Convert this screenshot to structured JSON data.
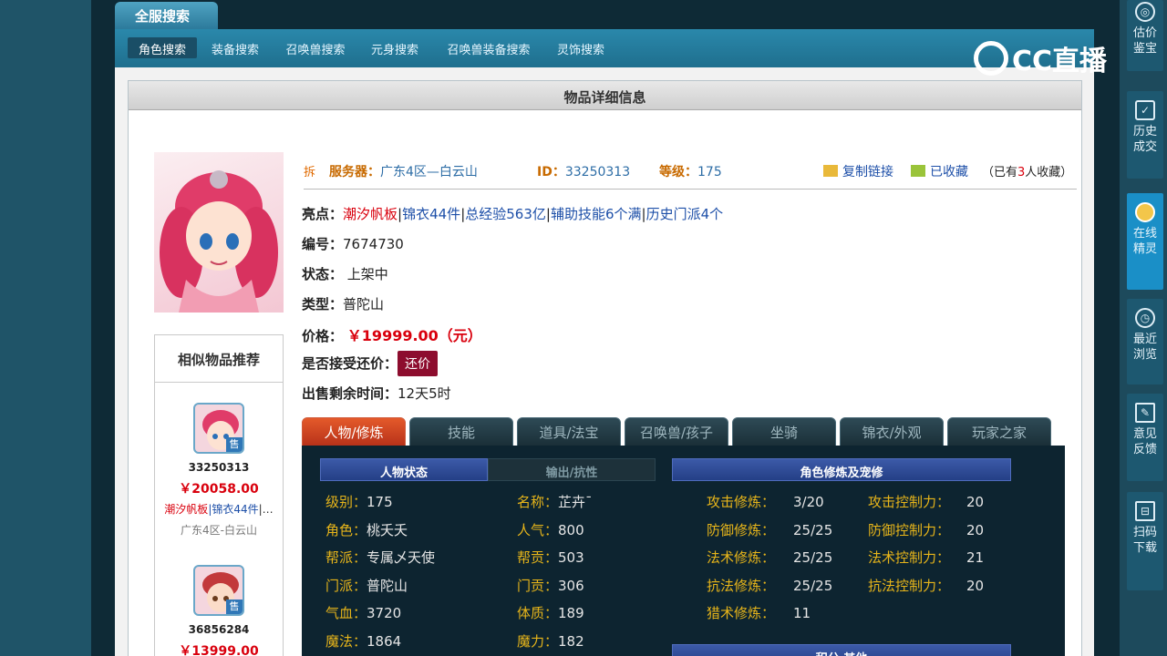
{
  "header": {
    "search_title": "全服搜索"
  },
  "tabs": [
    {
      "label": "角色搜索"
    },
    {
      "label": "装备搜索"
    },
    {
      "label": "召唤兽搜索"
    },
    {
      "label": "元身搜索"
    },
    {
      "label": "召唤兽装备搜索"
    },
    {
      "label": "灵饰搜索"
    }
  ],
  "panel": {
    "title": "物品详细信息"
  },
  "info": {
    "mark": "拆",
    "server_label": "服务器：",
    "server_value": "广东4区—白云山",
    "id_label": "ID：",
    "id_value": "33250313",
    "level_label": "等级：",
    "level_value": "175",
    "copy_link": "复制链接",
    "favorited": "已收藏",
    "fav_count_pre": "（已有",
    "fav_count": "3",
    "fav_count_post": "人收藏）"
  },
  "highlights": {
    "label": "亮点：",
    "items": [
      "潮汐帆板",
      "锦衣44件",
      "总经验563亿",
      "辅助技能6个满",
      "历史门派4个"
    ]
  },
  "details": {
    "serial_label": "编号：",
    "serial_value": "7674730",
    "status_label": "状态：",
    "status_value": "上架中",
    "type_label": "类型：",
    "type_value": "普陀山",
    "price_label": "价格：",
    "price_value": "￥19999.00（元）",
    "haggle_label": "是否接受还价：",
    "haggle_button": "还价",
    "remaining_label": "出售剩余时间：",
    "remaining_value": "12天5时"
  },
  "recommend": {
    "title": "相似物品推荐",
    "items": [
      {
        "id": "33250313",
        "price": "￥20058.00",
        "tag1": "潮汐帆板",
        "tag2": "锦衣44件",
        "more": "|…",
        "server": "广东4区-白云山",
        "sale": "售"
      },
      {
        "id": "36856284",
        "price": "￥13999.00",
        "sale": "售"
      }
    ]
  },
  "content_tabs": [
    "人物/修炼",
    "技能",
    "道具/法宝",
    "召唤兽/孩子",
    "坐骑",
    "锦衣/外观",
    "玩家之家"
  ],
  "char_status": {
    "head_active": "人物状态",
    "head_inactive": "输出/抗性",
    "rows_left": [
      {
        "k": "级别：",
        "v": "175"
      },
      {
        "k": "角色：",
        "v": "桃夭夭"
      },
      {
        "k": "帮派：",
        "v": "专属乄天使"
      },
      {
        "k": "门派：",
        "v": "普陀山"
      },
      {
        "k": "气血：",
        "v": "3720"
      },
      {
        "k": "魔法：",
        "v": "1864"
      }
    ],
    "rows_right": [
      {
        "k": "名称：",
        "v": "芷卉ˉ"
      },
      {
        "k": "人气：",
        "v": "800"
      },
      {
        "k": "帮贡：",
        "v": "503"
      },
      {
        "k": "门贡：",
        "v": "306"
      },
      {
        "k": "体质：",
        "v": "189"
      },
      {
        "k": "魔力：",
        "v": "182"
      }
    ]
  },
  "cultivation": {
    "head": "角色修炼及宠修",
    "rows_left": [
      {
        "k": "攻击修炼：",
        "v": "3/20"
      },
      {
        "k": "防御修炼：",
        "v": "25/25"
      },
      {
        "k": "法术修炼：",
        "v": "25/25"
      },
      {
        "k": "抗法修炼：",
        "v": "25/25"
      },
      {
        "k": "猎术修炼：",
        "v": "11"
      }
    ],
    "rows_right": [
      {
        "k": "攻击控制力：",
        "v": "20"
      },
      {
        "k": "防御控制力：",
        "v": "20"
      },
      {
        "k": "法术控制力：",
        "v": "21"
      },
      {
        "k": "抗法控制力：",
        "v": "20"
      }
    ],
    "next_head": "积分 其他"
  },
  "sidebar": [
    {
      "label1": "估价",
      "label2": "鉴宝",
      "icon": "appraise-icon"
    },
    {
      "label1": "历史",
      "label2": "成交",
      "icon": "history-deal-icon"
    },
    {
      "label1": "在线",
      "label2": "精灵",
      "icon": "sprite-icon"
    },
    {
      "label1": "最近",
      "label2": "浏览",
      "icon": "clock-icon"
    },
    {
      "label1": "意见",
      "label2": "反馈",
      "icon": "feedback-icon"
    },
    {
      "label1": "扫码",
      "label2": "下载",
      "icon": "scan-icon"
    }
  ],
  "watermark": "CC直播"
}
